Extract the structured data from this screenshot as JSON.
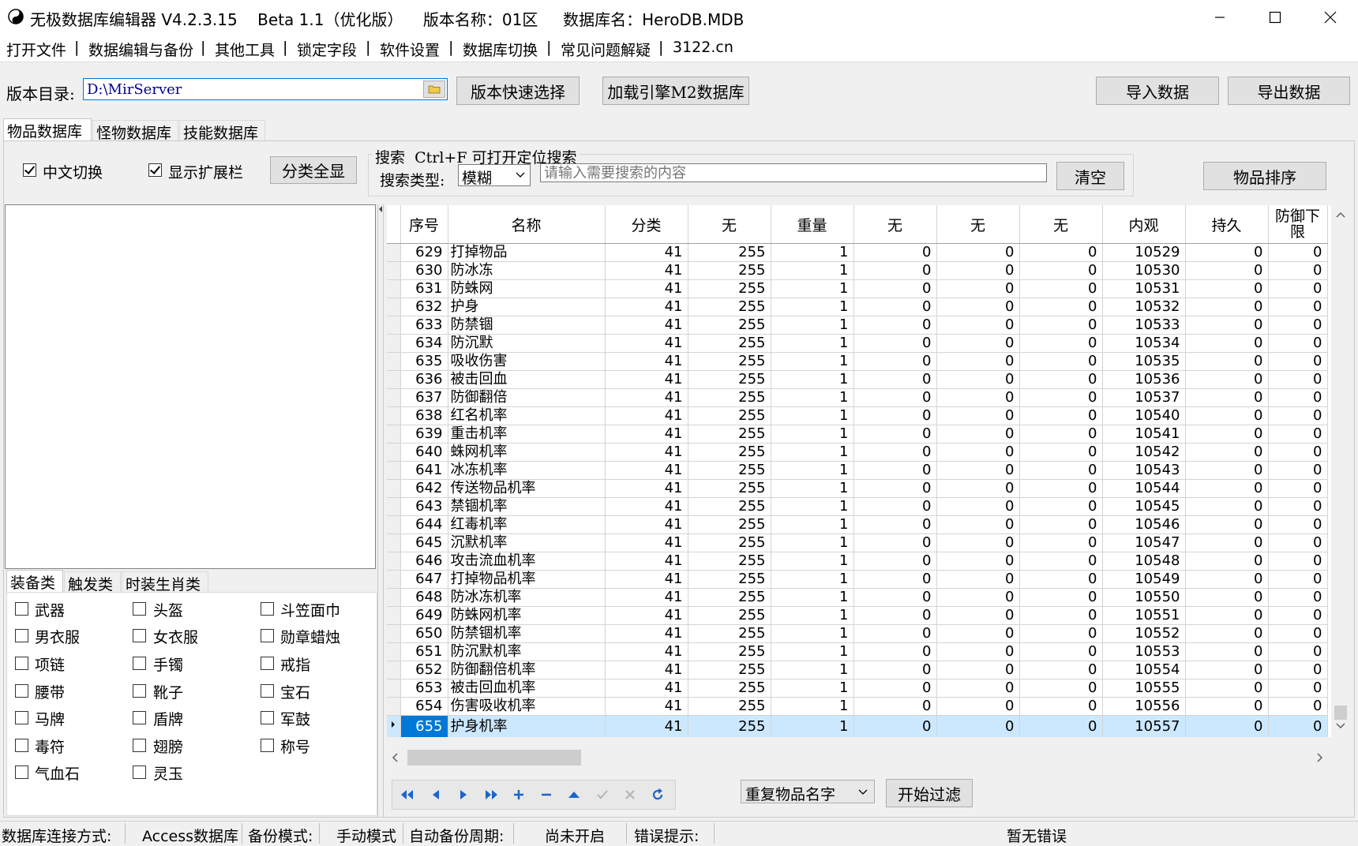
{
  "window": {
    "title": "无极数据库编辑器 V4.2.3.15    Beta 1.1（优化版）    版本名称：01区     数据库名：HeroDB.MDB"
  },
  "menu": [
    "打开文件",
    "数据编辑与备份",
    "其他工具",
    "锁定字段",
    "软件设置",
    "数据库切换",
    "常见问题解疑",
    "3122.cn"
  ],
  "toolbar": {
    "dir_label": "版本目录:",
    "dir_value": "D:\\MirServer",
    "quick_select": "版本快速选择",
    "load_m2": "加载引擎M2数据库",
    "import": "导入数据",
    "export": "导出数据"
  },
  "tabs": [
    "物品数据库",
    "怪物数据库",
    "技能数据库"
  ],
  "options": {
    "cn_switch": "中文切换",
    "show_ext": "显示扩展栏",
    "show_all": "分类全显",
    "search_title": "搜索  Ctrl+F 可打开定位搜索",
    "search_type_label": "搜索类型:",
    "search_type_value": "模糊",
    "search_placeholder": "请输入需要搜索的内容",
    "clear": "清空",
    "sort": "物品排序"
  },
  "category_tabs": [
    "装备类",
    "触发类",
    "时装生肖类"
  ],
  "categories": [
    "武器",
    "头盔",
    "斗笠面巾",
    "男衣服",
    "女衣服",
    "勋章蜡烛",
    "项链",
    "手镯",
    "戒指",
    "腰带",
    "靴子",
    "宝石",
    "马牌",
    "盾牌",
    "军鼓",
    "毒符",
    "翅膀",
    "称号",
    "气血石",
    "灵玉"
  ],
  "grid": {
    "columns": [
      "序号",
      "名称",
      "分类",
      "无",
      "重量",
      "无",
      "无",
      "无",
      "内观",
      "持久",
      "防御下限"
    ],
    "rows": [
      [
        629,
        "打掉物品",
        41,
        255,
        1,
        0,
        0,
        0,
        10529,
        0,
        0
      ],
      [
        630,
        "防冰冻",
        41,
        255,
        1,
        0,
        0,
        0,
        10530,
        0,
        0
      ],
      [
        631,
        "防蛛网",
        41,
        255,
        1,
        0,
        0,
        0,
        10531,
        0,
        0
      ],
      [
        632,
        "护身",
        41,
        255,
        1,
        0,
        0,
        0,
        10532,
        0,
        0
      ],
      [
        633,
        "防禁锢",
        41,
        255,
        1,
        0,
        0,
        0,
        10533,
        0,
        0
      ],
      [
        634,
        "防沉默",
        41,
        255,
        1,
        0,
        0,
        0,
        10534,
        0,
        0
      ],
      [
        635,
        "吸收伤害",
        41,
        255,
        1,
        0,
        0,
        0,
        10535,
        0,
        0
      ],
      [
        636,
        "被击回血",
        41,
        255,
        1,
        0,
        0,
        0,
        10536,
        0,
        0
      ],
      [
        637,
        "防御翻倍",
        41,
        255,
        1,
        0,
        0,
        0,
        10537,
        0,
        0
      ],
      [
        638,
        "红名机率",
        41,
        255,
        1,
        0,
        0,
        0,
        10540,
        0,
        0
      ],
      [
        639,
        "重击机率",
        41,
        255,
        1,
        0,
        0,
        0,
        10541,
        0,
        0
      ],
      [
        640,
        "蛛网机率",
        41,
        255,
        1,
        0,
        0,
        0,
        10542,
        0,
        0
      ],
      [
        641,
        "冰冻机率",
        41,
        255,
        1,
        0,
        0,
        0,
        10543,
        0,
        0
      ],
      [
        642,
        "传送物品机率",
        41,
        255,
        1,
        0,
        0,
        0,
        10544,
        0,
        0
      ],
      [
        643,
        "禁锢机率",
        41,
        255,
        1,
        0,
        0,
        0,
        10545,
        0,
        0
      ],
      [
        644,
        "红毒机率",
        41,
        255,
        1,
        0,
        0,
        0,
        10546,
        0,
        0
      ],
      [
        645,
        "沉默机率",
        41,
        255,
        1,
        0,
        0,
        0,
        10547,
        0,
        0
      ],
      [
        646,
        "攻击流血机率",
        41,
        255,
        1,
        0,
        0,
        0,
        10548,
        0,
        0
      ],
      [
        647,
        "打掉物品机率",
        41,
        255,
        1,
        0,
        0,
        0,
        10549,
        0,
        0
      ],
      [
        648,
        "防冰冻机率",
        41,
        255,
        1,
        0,
        0,
        0,
        10550,
        0,
        0
      ],
      [
        649,
        "防蛛网机率",
        41,
        255,
        1,
        0,
        0,
        0,
        10551,
        0,
        0
      ],
      [
        650,
        "防禁锢机率",
        41,
        255,
        1,
        0,
        0,
        0,
        10552,
        0,
        0
      ],
      [
        651,
        "防沉默机率",
        41,
        255,
        1,
        0,
        0,
        0,
        10553,
        0,
        0
      ],
      [
        652,
        "防御翻倍机率",
        41,
        255,
        1,
        0,
        0,
        0,
        10554,
        0,
        0
      ],
      [
        653,
        "被击回血机率",
        41,
        255,
        1,
        0,
        0,
        0,
        10555,
        0,
        0
      ],
      [
        654,
        "伤害吸收机率",
        41,
        255,
        1,
        0,
        0,
        0,
        10556,
        0,
        0
      ],
      [
        655,
        "护身机率",
        41,
        255,
        1,
        0,
        0,
        0,
        10557,
        0,
        0
      ]
    ],
    "selected_row": 26
  },
  "filter": {
    "dup_value": "重复物品名字",
    "start": "开始过滤"
  },
  "status": {
    "conn_label": "数据库连接方式:",
    "conn_value": "Access数据库",
    "backup_label": "备份模式:",
    "backup_value": "手动模式",
    "auto_label": "自动备份周期:",
    "auto_value": "尚未开启",
    "error_label": "错误提示:",
    "error_value": "暂无错误"
  }
}
